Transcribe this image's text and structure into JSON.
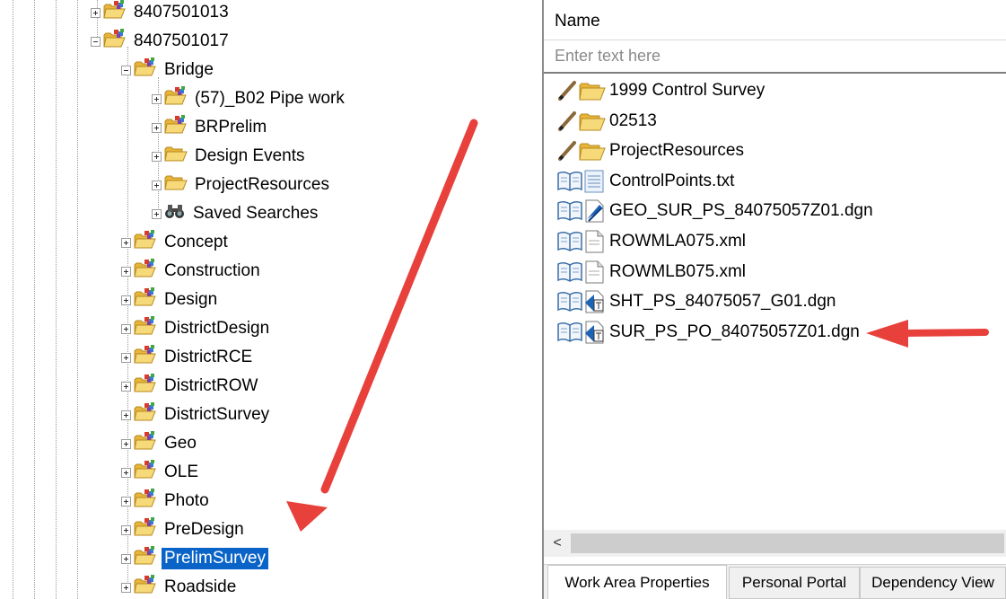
{
  "tree": {
    "items": [
      {
        "label": "8407501013",
        "icon": "project-folder-icon",
        "expander": "plus"
      },
      {
        "label": "8407501017",
        "icon": "project-folder-icon",
        "expander": "minus"
      },
      {
        "label": "Bridge",
        "icon": "project-folder-icon",
        "expander": "minus"
      },
      {
        "label": "(57)_B02 Pipe work",
        "icon": "project-folder-icon",
        "expander": "plus"
      },
      {
        "label": "BRPrelim",
        "icon": "project-folder-icon",
        "expander": "plus"
      },
      {
        "label": "Design Events",
        "icon": "folder-icon",
        "expander": "plus"
      },
      {
        "label": "ProjectResources",
        "icon": "folder-icon",
        "expander": "plus"
      },
      {
        "label": "Saved Searches",
        "icon": "binoculars-icon",
        "expander": "plus"
      },
      {
        "label": "Concept",
        "icon": "project-folder-icon",
        "expander": "plus"
      },
      {
        "label": "Construction",
        "icon": "project-folder-icon",
        "expander": "plus"
      },
      {
        "label": "Design",
        "icon": "project-folder-icon",
        "expander": "plus"
      },
      {
        "label": "DistrictDesign",
        "icon": "project-folder-icon",
        "expander": "plus"
      },
      {
        "label": "DistrictRCE",
        "icon": "project-folder-icon",
        "expander": "plus"
      },
      {
        "label": "DistrictROW",
        "icon": "project-folder-icon",
        "expander": "plus"
      },
      {
        "label": "DistrictSurvey",
        "icon": "project-folder-icon",
        "expander": "plus"
      },
      {
        "label": "Geo",
        "icon": "project-folder-icon",
        "expander": "plus"
      },
      {
        "label": "OLE",
        "icon": "project-folder-icon",
        "expander": "plus"
      },
      {
        "label": "Photo",
        "icon": "project-folder-icon",
        "expander": "plus"
      },
      {
        "label": "PreDesign",
        "icon": "project-folder-icon",
        "expander": "plus"
      },
      {
        "label": "PrelimSurvey",
        "icon": "project-folder-icon",
        "expander": "plus",
        "selected": true
      },
      {
        "label": "Roadside",
        "icon": "project-folder-icon",
        "expander": "plus"
      }
    ]
  },
  "panel": {
    "column_header": "Name",
    "filter_placeholder": "Enter text here",
    "files": [
      {
        "label": "1999 Control Survey",
        "icon": "pencil-folder-icon"
      },
      {
        "label": "02513",
        "icon": "pencil-folder-icon"
      },
      {
        "label": "ProjectResources",
        "icon": "pencil-folder-icon"
      },
      {
        "label": "ControlPoints.txt",
        "icon": "book-text-file-icon"
      },
      {
        "label": "GEO_SUR_PS_84075057Z01.dgn",
        "icon": "book-dgn-file-icon"
      },
      {
        "label": "ROWMLA075.xml",
        "icon": "book-xml-file-icon"
      },
      {
        "label": "ROWMLB075.xml",
        "icon": "book-xml-file-icon"
      },
      {
        "label": "SHT_PS_84075057_G01.dgn",
        "icon": "book-sheet-dgn-file-icon"
      },
      {
        "label": "SUR_PS_PO_84075057Z01.dgn",
        "icon": "book-sheet-dgn-file-icon"
      }
    ],
    "scroll_left_glyph": "<",
    "tabs": [
      {
        "label": "Work Area Properties",
        "active": true
      },
      {
        "label": "Personal Portal",
        "active": false
      },
      {
        "label": "Dependency View",
        "active": false
      }
    ]
  },
  "colors": {
    "selection": "#0a64c8",
    "arrow": "#e8413c",
    "folder": "#f2c94c"
  }
}
